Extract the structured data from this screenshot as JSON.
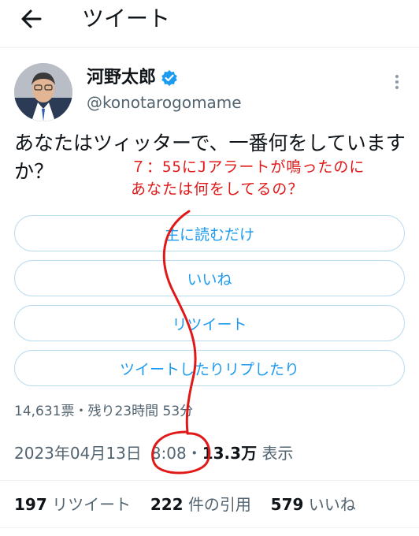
{
  "header": {
    "title": "ツイート",
    "back_icon": "arrow-left-icon"
  },
  "author": {
    "name": "河野太郎",
    "handle": "@konotarogomame",
    "verified_icon": "verified-badge-icon"
  },
  "tweet": {
    "text": "あなたはツィッターで、一番何をしていますか？"
  },
  "annotation": {
    "line1": "７：55にJアラートが鳴ったのに",
    "line2": "あなたは何をしてるの？",
    "color": "#e01818"
  },
  "poll": {
    "options": [
      "主に読むだけ",
      "いいね",
      "リツイート",
      "ツイートしたりリプしたり"
    ],
    "votes_summary": "14,631票・残り23時間 53分"
  },
  "timestamp": {
    "date": "2023年04月13日",
    "time": "8:08",
    "separator": "・",
    "views": "13.3万",
    "views_label": "表示"
  },
  "stats": {
    "retweets": "197",
    "retweets_label": "リツイート",
    "quotes": "222",
    "quotes_label": "件の引用",
    "likes": "579",
    "likes_label": "いいね"
  },
  "colors": {
    "accent": "#1d9bf0",
    "text": "#0f1419",
    "secondary": "#536471"
  }
}
